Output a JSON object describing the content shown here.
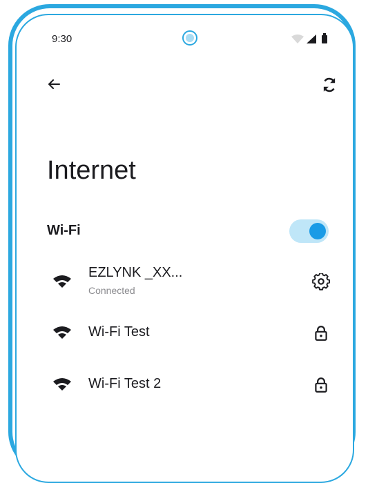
{
  "status_bar": {
    "time": "9:30",
    "icons": [
      "wifi-icon",
      "signal-icon",
      "battery-icon"
    ]
  },
  "toolbar": {
    "back_icon": "arrow-left-icon",
    "refresh_icon": "refresh-icon"
  },
  "page": {
    "title": "Internet"
  },
  "wifi": {
    "label": "Wi-Fi",
    "enabled": true,
    "networks": [
      {
        "name": "EZLYNK _XX...",
        "status": "Connected",
        "action_icon": "gear-icon"
      },
      {
        "name": "Wi-Fi Test",
        "status": "",
        "action_icon": "lock-icon"
      },
      {
        "name": "Wi-Fi Test 2",
        "status": "",
        "action_icon": "lock-icon"
      }
    ]
  },
  "colors": {
    "accent": "#2ba8e0",
    "toggle_track": "#bfe6f8",
    "toggle_knob": "#1a9be6",
    "subtext": "#8a8a8e"
  }
}
